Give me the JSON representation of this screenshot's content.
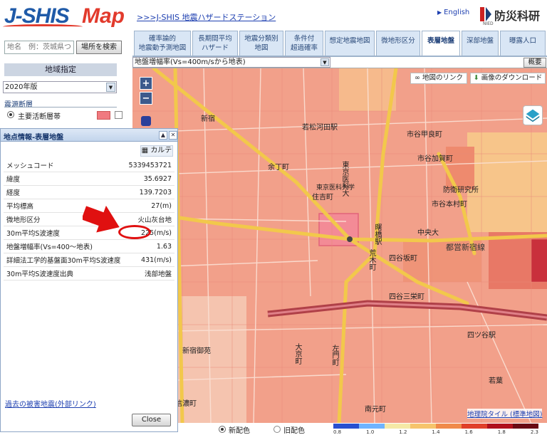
{
  "header": {
    "logo_j": "J-SHIS",
    "logo_map": "Map",
    "station_link": ">>>J-SHIS 地震ハザードステーション",
    "english": "English",
    "org_name": "防災科研",
    "org_abbr": "NIED"
  },
  "search": {
    "placeholder": "地名　例：茨城県つくば",
    "button": "場所を検索"
  },
  "tabs": [
    {
      "label": "確率論的\n地震動予測地図"
    },
    {
      "label": "長期間平均\nハザード"
    },
    {
      "label": "地震分類別\n地図"
    },
    {
      "label": "条件付\n超過確率"
    },
    {
      "label": "想定地震地図"
    },
    {
      "label": "微地形区分"
    },
    {
      "label": "表層地盤",
      "active": true
    },
    {
      "label": "深部地盤"
    },
    {
      "label": "曝露人口"
    }
  ],
  "sidebar": {
    "area_header": "地域指定",
    "year": "2020年版",
    "fault_header": "震源断層",
    "fault_item": "主要活断層帯"
  },
  "map": {
    "layer": "地盤増幅率(Vs=400m/sから地表)",
    "overview": "概要",
    "map_link": "地図のリンク",
    "download": "画像のダウンロード",
    "attribution": "地理院タイル (標準地図)",
    "labels": [
      "新宿",
      "若松河田駅",
      "余丁町",
      "住吉町",
      "東京医科大",
      "市谷甲良町",
      "市谷加賀町",
      "市谷本村町",
      "防衛研究所",
      "中央大",
      "都営新宿線",
      "四谷坂町",
      "四谷三栄町",
      "荒木町",
      "新宿御苑",
      "大京町",
      "左門町",
      "四ツ谷駅",
      "南元町",
      "東京医科大学",
      "曙橋駅",
      "若葉",
      "信濃町"
    ]
  },
  "colors": {
    "new": "新配色",
    "old": "旧配色",
    "legend_colors": [
      "#2850d0",
      "#6fb4ff",
      "#f5e9a6",
      "#f6c46c",
      "#f08a4a",
      "#e0402a",
      "#b0101c",
      "#6a0a14"
    ],
    "legend_ticks": [
      "0.8",
      "1.0",
      "1.2",
      "1.4",
      "1.6",
      "1.8",
      "2.3"
    ]
  },
  "info_panel": {
    "title": "地点情報-表層地盤",
    "karte": "カルテ",
    "rows": [
      {
        "label": "メッシュコード",
        "value": "5339453721"
      },
      {
        "label": "緯度",
        "value": "35.6927"
      },
      {
        "label": "経度",
        "value": "139.7203"
      },
      {
        "label": "平均標高",
        "value": "27(m)"
      },
      {
        "label": "微地形区分",
        "value": "火山灰台地"
      },
      {
        "label": "30m平均S波速度",
        "value": "225(m/s)"
      },
      {
        "label": "地盤増幅率(Vs=400～地表)",
        "value": "1.63"
      },
      {
        "label": "詳細法工学的基盤面30m平均S波速度",
        "value": "431(m/s)"
      },
      {
        "label": "30m平均S波速度出典",
        "value": "浅部地盤"
      }
    ],
    "past_link": "過去の被害地震(外部リンク)",
    "close": "Close"
  }
}
